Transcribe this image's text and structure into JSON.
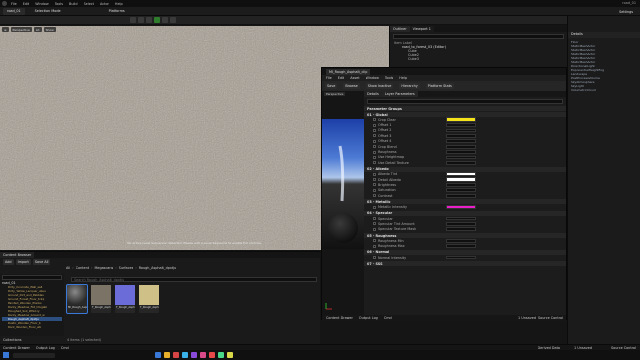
{
  "menu": [
    "File",
    "Edit",
    "Window",
    "Tools",
    "Build",
    "Select",
    "Actor",
    "Help"
  ],
  "tabs": {
    "level": "Selection Mode",
    "platform": "Platforms"
  },
  "window_title": "road_01",
  "settings_label": "Settings",
  "viewport": {
    "buttons": [
      "Perspective",
      "Lit",
      "Show"
    ],
    "notice": "No active Level Sequencer detected. Please edit a Level Sequence to enable full controls."
  },
  "outliner": {
    "tabs": [
      "Outliner",
      "Viewport 1"
    ],
    "header": "Item Label",
    "items": [
      "road_to_forest_03 (Editor)",
      "Cube",
      "Cube2",
      "Cube3"
    ]
  },
  "details": {
    "title": "Details",
    "items": [
      "Floor",
      "StaticMeshActor",
      "StaticMeshActor",
      "StaticMeshActor",
      "StaticMeshActor",
      "StaticMeshActor",
      "DirectionalLight",
      "ExponentialHeightFog",
      "Landscape",
      "PostProcessVolume",
      "SkyAtmosphere",
      "SkyLight",
      "VolumetricCloud"
    ]
  },
  "mat_editor": {
    "tab_title": "MI_Rough_Asphalt_clip",
    "menu": [
      "File",
      "Edit",
      "Asset",
      "Window",
      "Tools",
      "Help"
    ],
    "toolbar": [
      "Save",
      "Browse",
      "Show Inactive",
      "Hierarchy",
      "Platform Stats"
    ],
    "preview_label": "Perspective",
    "panel_tabs": [
      "Details",
      "Layer Parameters"
    ],
    "sections": [
      {
        "name": "Parameter Groups",
        "props": []
      },
      {
        "name": "01 - Global",
        "props": [
          "Crop Clear",
          "Offset 1",
          "Offset 2",
          "Offset 3",
          "Offset 4",
          "Crop Blend",
          "Roughness",
          "Use Heightmap",
          "Use Detail Texture"
        ]
      },
      {
        "name": "02 - Albedo",
        "props": [
          "Albedo Tint",
          "Detail Albedo",
          "Brightness",
          "Saturation",
          "Contrast"
        ]
      },
      {
        "name": "03 - Metallic",
        "props": [
          "Metallic Intensity"
        ]
      },
      {
        "name": "04 - Specular",
        "props": [
          "Specular",
          "Specular Tint Amount",
          "Specular Texture Mask"
        ]
      },
      {
        "name": "05 - Roughness",
        "props": [
          "Roughness Min",
          "Roughness Max"
        ]
      },
      {
        "name": "06 - Normal",
        "props": [
          "Normal Intensity"
        ]
      },
      {
        "name": "07 - SSS",
        "props": []
      }
    ],
    "swatch_colors": {
      "crop": "#f5e21a",
      "albedo": "#ffffff",
      "metallic": "#e81ec8"
    },
    "bottom_tabs": [
      "Content Drawer",
      "Output Log",
      "Cmd"
    ],
    "unsaved": "1 Unsaved",
    "source_control": "Source Control"
  },
  "content_browser": {
    "title": "Content Browser",
    "buttons": [
      "Add",
      "Import",
      "Save All"
    ],
    "path": [
      "All",
      "Content",
      "Megascans",
      "Surfaces",
      "Rough_Asphalt_dpxtju"
    ],
    "search_placeholder": "Search Rough_Asphalt_dpxtju",
    "folder_root": "road_01",
    "folders": [
      "Dirty_Concrete_Wall_se4",
      "Dirty_Yellow_Lacquer_ubuu",
      "Ground_Dirt_and_Pebbles",
      "Ground_Forest_Floor_tc2q",
      "Painted_Wooden_Planks",
      "Rocky_Meadow_Fbt_tdvgabl",
      "Ploughed_Soil_Whk1ry",
      "Rocky_Meadow_Ground_w",
      "Rough_Asphalt_dpxtju",
      "Rustic_Wooden_Floor_b",
      "Rock_Wooden_Floor_wb"
    ],
    "assets": [
      {
        "label": "MI_Rough_Asphalt",
        "color": "#5a5a5a"
      },
      {
        "label": "T_Rough_Asphalt_D",
        "color": "#7b7366"
      },
      {
        "label": "T_Rough_Asphalt_N",
        "color": "#6c6cd8"
      },
      {
        "label": "T_Rough_Asphalt_ORDp",
        "color": "#cfc087"
      }
    ],
    "collections": "Collections",
    "item_count": "4 items (1 selected)"
  },
  "status_bar": {
    "tabs": [
      "Content Drawer",
      "Output Log",
      "Cmd"
    ],
    "derived": "Derived Data",
    "unsaved": "1 Unsaved",
    "source_control": "Source Control"
  },
  "taskbar": {
    "icons": [
      "#3a78d8",
      "#e8b02a",
      "#d64545",
      "#3ab0e8",
      "#8a4adb",
      "#d84a8a",
      "#e84a4a",
      "#4ad88a",
      "#d8d84a"
    ]
  }
}
